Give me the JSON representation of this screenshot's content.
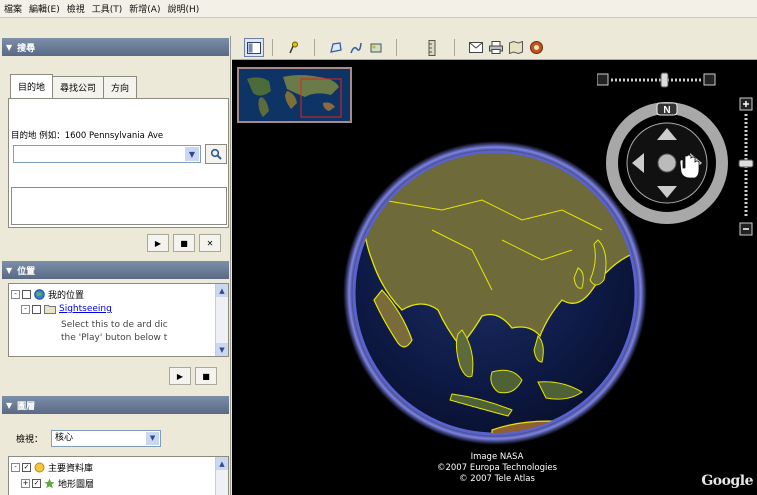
{
  "menu": [
    "檔案",
    "編輯(E)",
    "檢視",
    "工具(T)",
    "新增(A)",
    "說明(H)"
  ],
  "search_panel": {
    "title": "搜尋",
    "tabs": [
      "目的地",
      "尋找公司",
      "方向"
    ],
    "label": "目的地 例如：1600 Pennsylvania Ave",
    "input_value": ""
  },
  "places_panel": {
    "title": "位置",
    "items": [
      {
        "label": "我的位置",
        "expander": "-",
        "checked": false
      },
      {
        "label": "Sightseeing",
        "expander": "-",
        "checked": false
      }
    ],
    "description": [
      "Select this to de ard dic",
      "the 'Play' buton below t"
    ]
  },
  "layers_panel": {
    "title": "圖層",
    "view_label": "檢視：",
    "view_value": "核心",
    "items": [
      {
        "label": "主要資料庫",
        "expander": "-",
        "checked": true
      },
      {
        "label": "地形圖層",
        "expander": "+",
        "checked": true
      }
    ]
  },
  "attribution": [
    "Image NASA",
    "©2007 Europa Technologies",
    "© 2007 Tele Atlas"
  ],
  "google_logo": "Google",
  "compass_north": "N",
  "colors": {
    "header": "#6b7b96",
    "globe_border": "#6b73d8",
    "borders": "#e6e600"
  }
}
